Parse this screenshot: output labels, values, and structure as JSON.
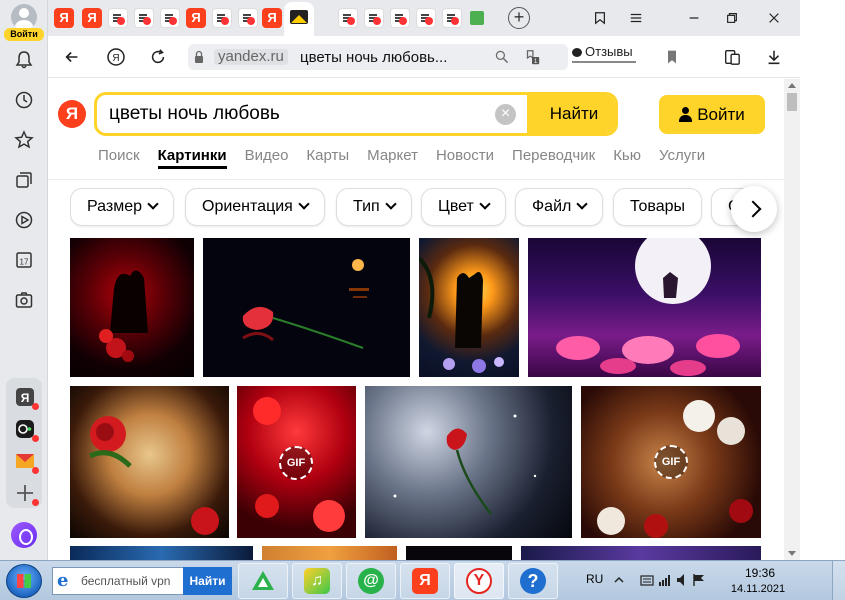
{
  "sidebar": {
    "profile_label": "Войти",
    "icons": [
      "bell-icon",
      "history-icon",
      "bookmarks-star-icon",
      "collections-icon",
      "video-play-icon",
      "calendar-icon",
      "screenshot-camera-icon"
    ],
    "calendar_day": "17",
    "apps": [
      {
        "name": "yandex-app-icon",
        "glyph": "Я",
        "color": "#444444"
      },
      {
        "name": "messenger-app-icon",
        "glyph": "●",
        "color": "#1a1a1a"
      },
      {
        "name": "mail-app-icon",
        "glyph": "✉",
        "color": "#f5a623"
      },
      {
        "name": "add-app-icon",
        "glyph": "+",
        "color": "#555555"
      }
    ]
  },
  "tabs": {
    "count_visible": 22
  },
  "addressbar": {
    "domain": "yandex.ru",
    "page_title": "цветы ночь любовь...",
    "reviews_label": "Отзывы"
  },
  "search": {
    "logo": "Я",
    "query": "цветы ночь любовь",
    "button": "Найти",
    "clear_glyph": "×"
  },
  "login_button": "Войти",
  "services": [
    "Поиск",
    "Картинки",
    "Видео",
    "Карты",
    "Маркет",
    "Новости",
    "Переводчик",
    "Кью",
    "Услуги"
  ],
  "services_active": "Картинки",
  "filters": [
    {
      "label": "Размер",
      "dropdown": true
    },
    {
      "label": "Ориентация",
      "dropdown": true
    },
    {
      "label": "Тип",
      "dropdown": true
    },
    {
      "label": "Цвет",
      "dropdown": true
    },
    {
      "label": "Файл",
      "dropdown": true
    },
    {
      "label": "Товары",
      "dropdown": false
    },
    {
      "label": "С",
      "dropdown": false
    }
  ],
  "image_badges": {
    "gif": "GIF"
  },
  "taskbar": {
    "search_text": "бесплатный vpn",
    "search_button": "Найти",
    "lang": "RU",
    "time": "19:36",
    "date": "14.11.2021"
  },
  "colors": {
    "accent_yellow": "#fed42b",
    "yandex_red": "#fc3f1d",
    "chrome_bg": "#e7e9ed"
  }
}
